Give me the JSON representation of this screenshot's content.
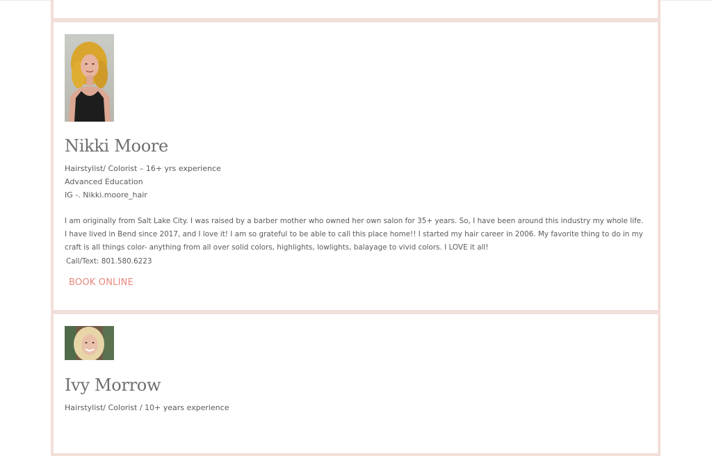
{
  "team": [
    {
      "name": "Nikki Moore",
      "photo_icon": "nikki-portrait",
      "details": [
        "Hairstylist/ Colorist – 16+ yrs experience",
        "Advanced Education",
        "IG -.  Nikki.moore_hair"
      ],
      "bio": "I am originally from Salt Lake City. I was raised by a barber mother who owned her own salon for 35+ years. So, I have been around this industry my whole life. I have lived in Bend since 2017, and I love it! I am so grateful to be able to call this place home!! I started my hair career in 2006. My favorite thing to do in my craft is all things color- anything from all over solid colors, highlights,  lowlights, balayage to vivid colors.  I LOVE it all!",
      "phone": "Call/Text: 801.580.6223",
      "book_label": "BOOK ONLINE"
    },
    {
      "name": "Ivy Morrow",
      "photo_icon": "ivy-portrait",
      "details": [
        "Hairstylist/ Colorist / 10+ years experience"
      ]
    }
  ],
  "colors": {
    "card_border": "#f2dfd9",
    "book_link": "#e8877e",
    "name_text": "#6e6e6e",
    "body_text": "#5a5a5a"
  }
}
